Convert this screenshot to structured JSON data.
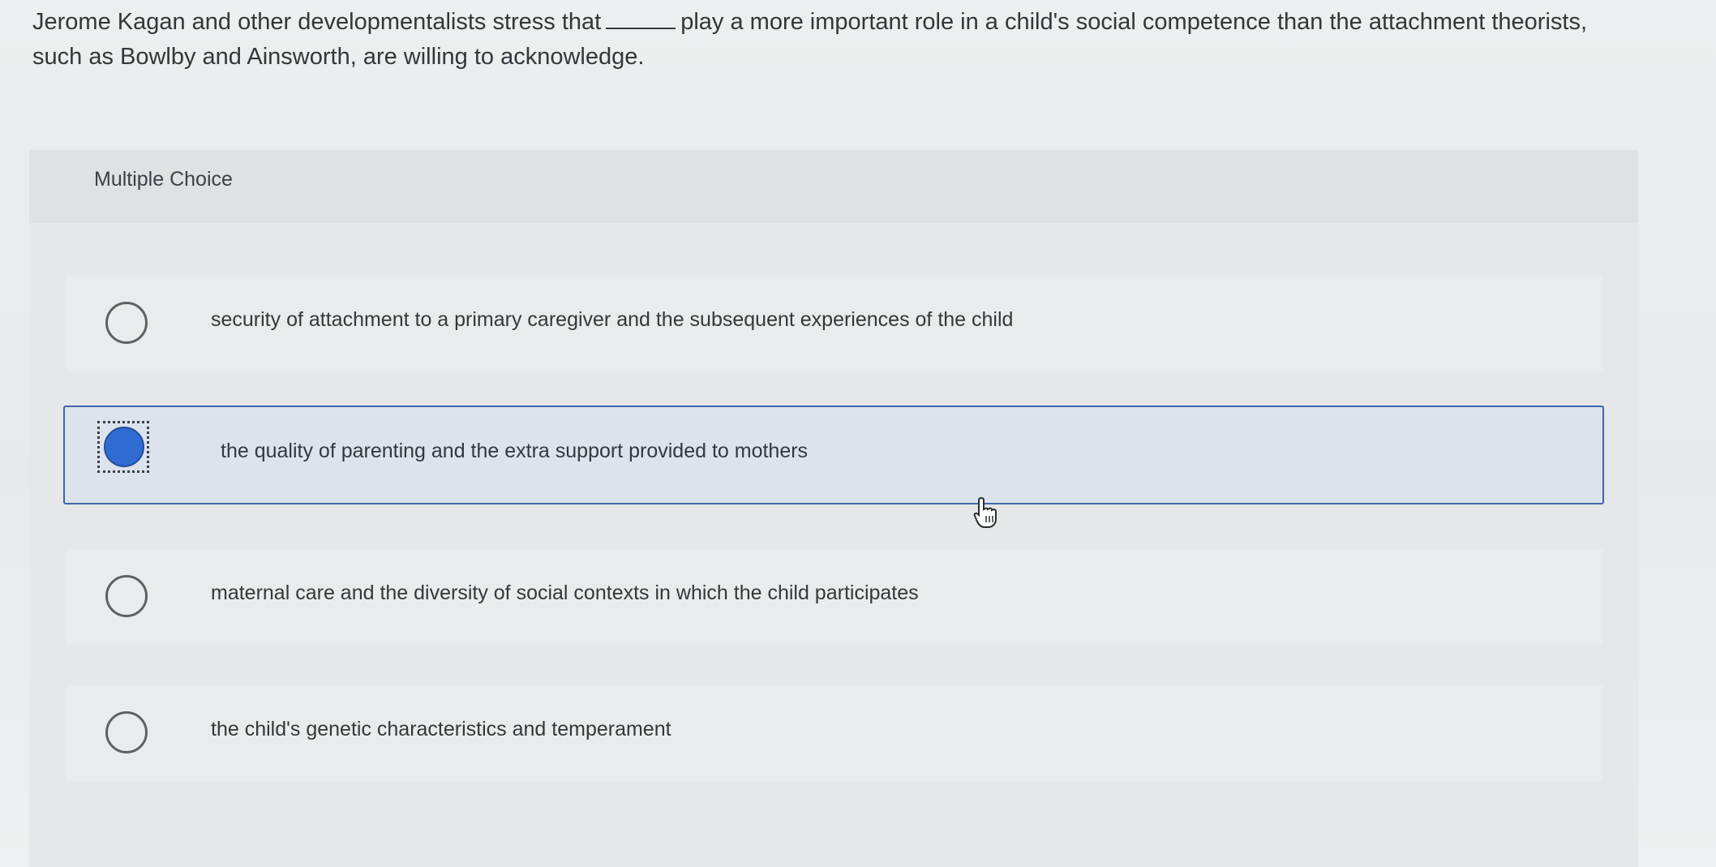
{
  "question": {
    "text_before": "Jerome Kagan and other developmentalists stress that",
    "text_after": "play a more important role in a child's social competence than the attachment theorists, such as Bowlby and Ainsworth, are willing to acknowledge."
  },
  "panel": {
    "title": "Multiple Choice"
  },
  "options": [
    {
      "label": "security of attachment to a primary caregiver and the subsequent experiences of the child",
      "selected": false
    },
    {
      "label": "the quality of parenting and the extra support provided to mothers",
      "selected": true
    },
    {
      "label": "maternal care and the diversity of social contexts in which the child participates",
      "selected": false
    },
    {
      "label": "the child's genetic characteristics and temperament",
      "selected": false
    }
  ],
  "colors": {
    "selected_fill": "#2f6bd2",
    "selected_border": "#3f66a8"
  },
  "icons": {
    "cursor": "hand-pointer-icon"
  }
}
